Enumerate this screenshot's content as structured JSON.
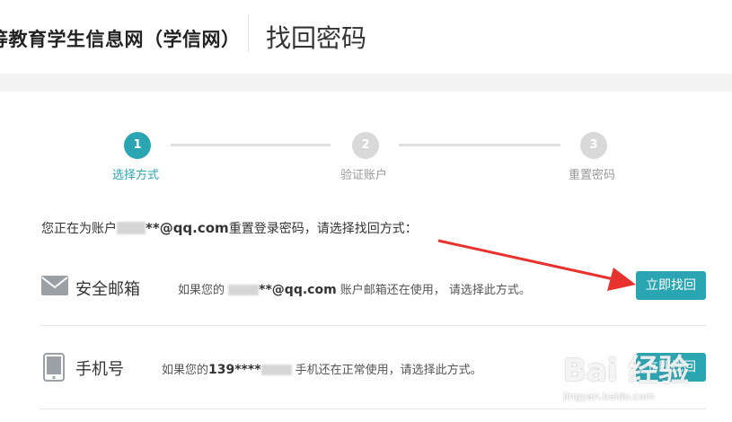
{
  "header": {
    "site_name": "等教育学生信息网（学信网）",
    "page_title": "找回密码"
  },
  "steps": [
    {
      "number": "1",
      "label": "选择方式",
      "active": true
    },
    {
      "number": "2",
      "label": "验证账户",
      "active": false
    },
    {
      "number": "3",
      "label": "重置密码",
      "active": false
    }
  ],
  "intro": {
    "prefix": "您正在为账户",
    "email_masked": "**@qq.com",
    "suffix": "重置登录密码，请选择找回方式："
  },
  "options": {
    "email": {
      "icon": "mail-icon",
      "name": "安全邮箱",
      "desc_prefix": "如果您的",
      "desc_value": "**@qq.com",
      "desc_suffix": " 账户邮箱还在使用，  请选择此方式。",
      "button": "立即找回"
    },
    "phone": {
      "icon": "phone-icon",
      "name": "手机号",
      "desc_prefix": "如果您的",
      "desc_value": "139****",
      "desc_suffix": " 手机还在正常使用，请选择此方式。",
      "button": "立即找回"
    }
  },
  "watermark": {
    "text": "Bai 经验",
    "url": "jingyan.baidu.com"
  },
  "colors": {
    "accent": "#2aa6b2",
    "arrow": "#e8322d",
    "inactive_step": "#d9d9d9"
  }
}
